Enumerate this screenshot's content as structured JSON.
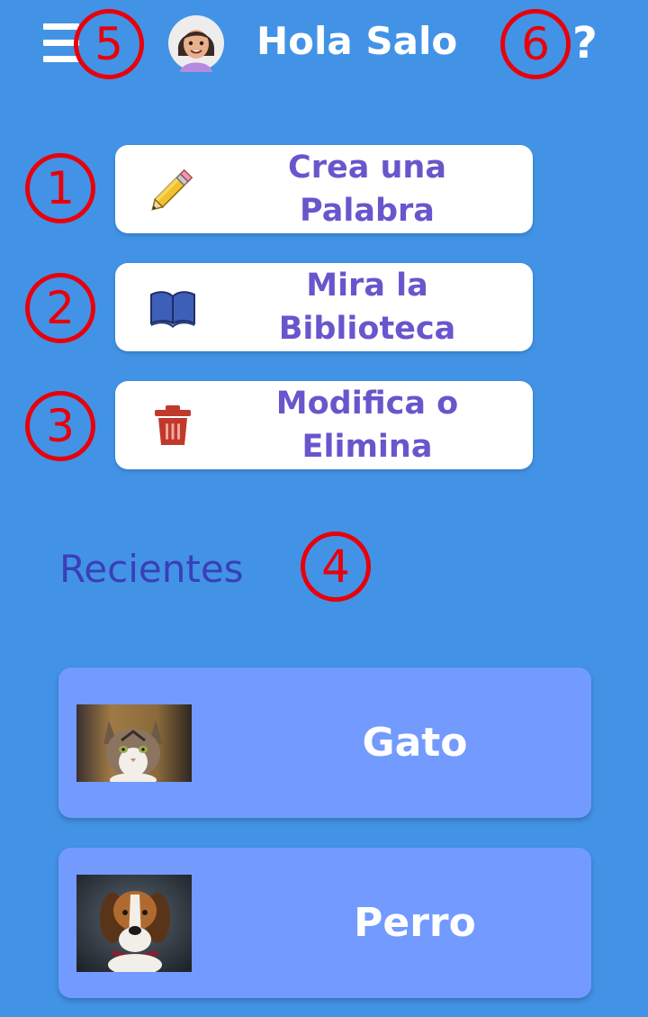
{
  "header": {
    "greeting": "Hola Salo",
    "help_label": "?",
    "menu_icon": "hamburger-menu-icon",
    "avatar_icon": "user-avatar-icon"
  },
  "annotations": [
    "1",
    "2",
    "3",
    "4",
    "5",
    "6"
  ],
  "actions": [
    {
      "label": "Crea una\nPalabra",
      "icon": "pencil-icon"
    },
    {
      "label": "Mira la\nBiblioteca",
      "icon": "book-icon"
    },
    {
      "label": "Modifica o\nElimina",
      "icon": "trash-icon"
    }
  ],
  "recent": {
    "title": "Recientes",
    "items": [
      {
        "label": "Gato",
        "image": "cat-photo"
      },
      {
        "label": "Perro",
        "image": "dog-photo"
      }
    ]
  },
  "colors": {
    "background": "#4293E6",
    "button_text": "#6A55CC",
    "section_title": "#3A3FB8",
    "card_background": "#729AFF",
    "annotation": "#E8000B"
  }
}
